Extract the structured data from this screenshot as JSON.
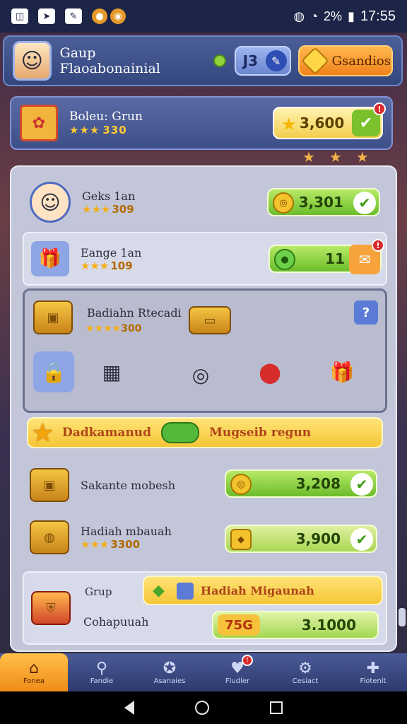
{
  "statusbar": {
    "time": "17:55",
    "battery_label": "2%"
  },
  "header": {
    "title": "Gaup Flaoabonainial",
    "pill_value": "J3",
    "button_label": "Gsandios"
  },
  "banner": {
    "title": "Boleu: Grun",
    "stars_value": "330",
    "score": "3,600",
    "badge": "!"
  },
  "rows": [
    {
      "title": "Geks 1an",
      "stars_value": "309",
      "value": "3,301"
    },
    {
      "title": "Eange 1an",
      "stars_value": "109",
      "value": "11",
      "badge": "!"
    }
  ],
  "reward": {
    "title": "Badiahn Rtecadi",
    "stars_value": "300"
  },
  "ybanner": {
    "left_text": "Dadkamanud",
    "right_text": "Mugseib regun"
  },
  "rows2": [
    {
      "title": "Sakante mobesh",
      "value": "3,208"
    },
    {
      "title": "Hadiah mbauah",
      "stars_value": "3300",
      "value": "3,900"
    }
  ],
  "bottom": {
    "label1": "Grup",
    "banner_text": "Hadiah Migaunah",
    "label2": "Cohapuuah",
    "tag": "75G",
    "value": "3.1000"
  },
  "nav": [
    {
      "label": "Fonea",
      "icon": "home-icon"
    },
    {
      "label": "Fandie",
      "icon": "search-icon"
    },
    {
      "label": "Asanaies",
      "icon": "compass-icon"
    },
    {
      "label": "Fludler",
      "icon": "heart-icon",
      "badge": "!"
    },
    {
      "label": "Cesiact",
      "icon": "gear-icon"
    },
    {
      "label": "Fiotenit",
      "icon": "puzzle-icon"
    }
  ],
  "colors": {
    "accent": "#f5a623",
    "panel": "#c3c6d8",
    "green": "#6bbd2b"
  }
}
